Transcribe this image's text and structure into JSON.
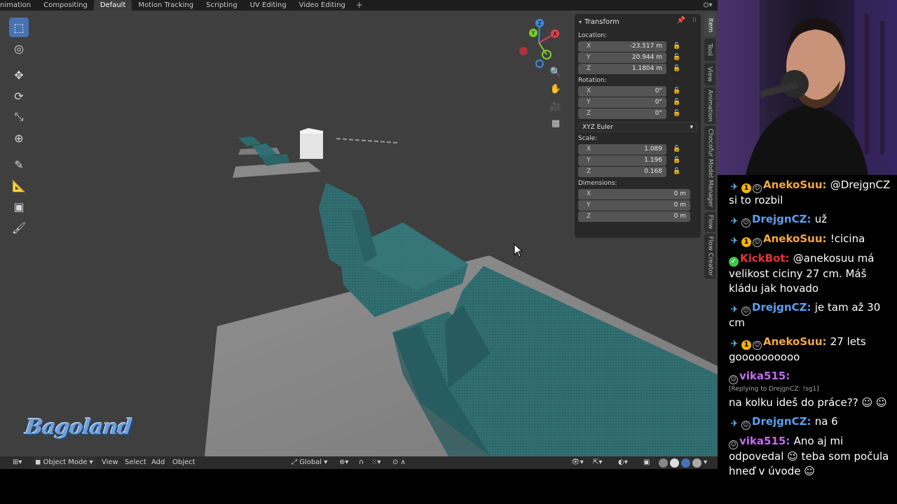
{
  "workspace_tabs": [
    "nimation",
    "Compositing",
    "Default",
    "Motion Tracking",
    "Scripting",
    "UV Editing",
    "Video Editing"
  ],
  "active_tab": "Default",
  "add_workspace": "+",
  "transform_panel": {
    "title": "Transform",
    "location_label": "Location:",
    "location": [
      {
        "k": "X",
        "v": "-23.517 m"
      },
      {
        "k": "Y",
        "v": "20.944 m"
      },
      {
        "k": "Z",
        "v": "1.1804 m"
      }
    ],
    "rotation_label": "Rotation:",
    "rotation": [
      {
        "k": "X",
        "v": "0°"
      },
      {
        "k": "Y",
        "v": "0°"
      },
      {
        "k": "Z",
        "v": "0°"
      }
    ],
    "rotation_mode": "XYZ Euler",
    "scale_label": "Scale:",
    "scale": [
      {
        "k": "X",
        "v": "1.089"
      },
      {
        "k": "Y",
        "v": "1.196"
      },
      {
        "k": "Z",
        "v": "0.168"
      }
    ],
    "dimensions_label": "Dimensions:",
    "dimensions": [
      {
        "k": "X",
        "v": "0 m"
      },
      {
        "k": "Y",
        "v": "0 m"
      },
      {
        "k": "Z",
        "v": "0 m"
      }
    ]
  },
  "sidebar_tabs": [
    "Item",
    "Tool",
    "View",
    "Animation",
    "Chocofur Model Manager",
    "Flow",
    "Flow Creator"
  ],
  "gizmo_axes": {
    "x": "X",
    "y": "Y",
    "z": "Z"
  },
  "bottom_bar": {
    "mode": "Object Mode",
    "menus": [
      "View",
      "Select",
      "Add",
      "Object"
    ],
    "transform_orientation": "Global"
  },
  "logo_text": "Bagoland",
  "colors": {
    "viewport_bg": "#3f3f3f",
    "floor": "#8d8d8d",
    "sofa": "#2f6b6e",
    "sofa_light": "#4a8a8c",
    "active_tool": "#4772b3",
    "axis_x": "#e0404f",
    "axis_y": "#7ecc2a",
    "axis_z": "#3c8bdf"
  },
  "chat": [
    {
      "badges": [
        "sword",
        "one",
        "smile"
      ],
      "user": "AnekoSuu",
      "color": "#f4a942",
      "text": "@DrejgnCZ si to rozbil"
    },
    {
      "badges": [
        "sword",
        "smile"
      ],
      "user": "DrejgnCZ",
      "color": "#5aa0f0",
      "text": "už"
    },
    {
      "badges": [
        "sword",
        "one",
        "smile"
      ],
      "user": "AnekoSuu",
      "color": "#f4a942",
      "text": "!cicina"
    },
    {
      "badges": [
        "check"
      ],
      "user": "KickBot",
      "color": "#e8323c",
      "text": "@anekosuu má velikost ciciny 27 cm. Máš kládu jak hovado"
    },
    {
      "badges": [
        "sword",
        "smile"
      ],
      "user": "DrejgnCZ",
      "color": "#5aa0f0",
      "text": "je tam až 30 cm"
    },
    {
      "badges": [
        "sword",
        "one",
        "smile"
      ],
      "user": "AnekoSuu",
      "color": "#f4a942",
      "text": "27 lets goooooooooo"
    },
    {
      "badges": [
        "smile"
      ],
      "user": "vika515",
      "color": "#c36cf0",
      "reply": "[Replying to DrejgnCZ: !sg1]",
      "text": "na kolku ideš do práce?? ☺ ☺"
    },
    {
      "badges": [
        "sword",
        "smile"
      ],
      "user": "DrejgnCZ",
      "color": "#5aa0f0",
      "text": "na 6"
    },
    {
      "badges": [
        "smile"
      ],
      "user": "vika515",
      "color": "#c36cf0",
      "text": "Ano aj mi odpovedal 😉 teba som počula hneď v úvode ☺"
    }
  ]
}
